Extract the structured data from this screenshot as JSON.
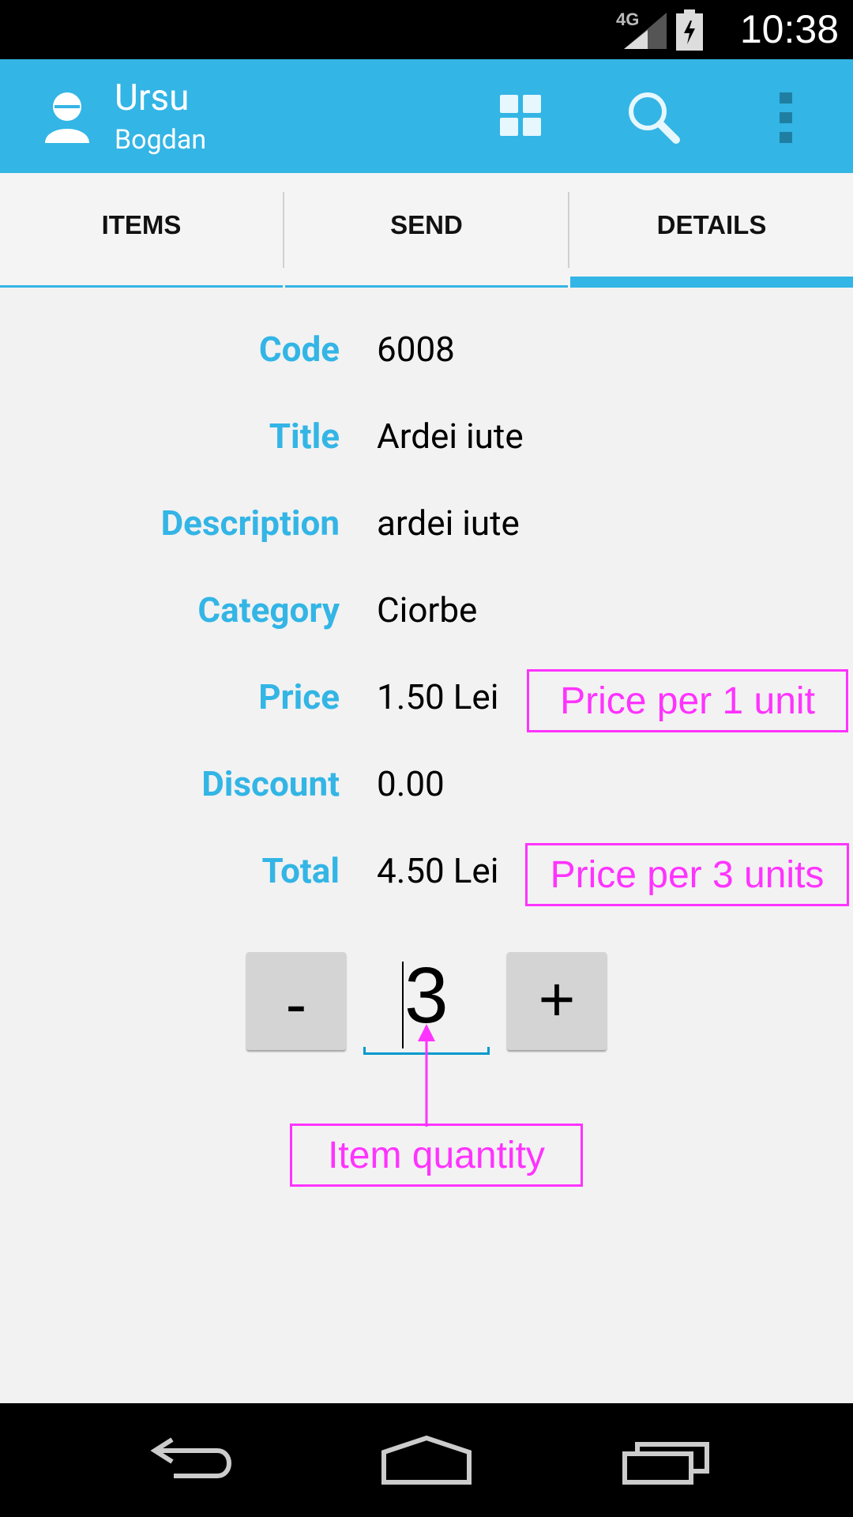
{
  "status_bar": {
    "network": "4G",
    "time": "10:38"
  },
  "action_bar": {
    "title": "Ursu",
    "subtitle": "Bogdan"
  },
  "tabs": [
    {
      "label": "ITEMS",
      "selected": false
    },
    {
      "label": "SEND",
      "selected": false
    },
    {
      "label": "DETAILS",
      "selected": true
    }
  ],
  "details": [
    {
      "label": "Code",
      "value": "6008"
    },
    {
      "label": "Title",
      "value": "Ardei iute"
    },
    {
      "label": "Description",
      "value": "ardei iute"
    },
    {
      "label": "Category",
      "value": "Ciorbe"
    },
    {
      "label": "Price",
      "value": "1.50 Lei"
    },
    {
      "label": "Discount",
      "value": "0.00"
    },
    {
      "label": "Total",
      "value": "4.50 Lei"
    }
  ],
  "quantity": {
    "decrement_label": "-",
    "value": "3",
    "increment_label": "+"
  },
  "annotations": {
    "price_unit": "Price per 1 unit",
    "price_total": "Price per 3 units",
    "item_quantity": "Item quantity"
  },
  "colors": {
    "accent": "#33b5e5",
    "annotation": "#ff33ff"
  }
}
